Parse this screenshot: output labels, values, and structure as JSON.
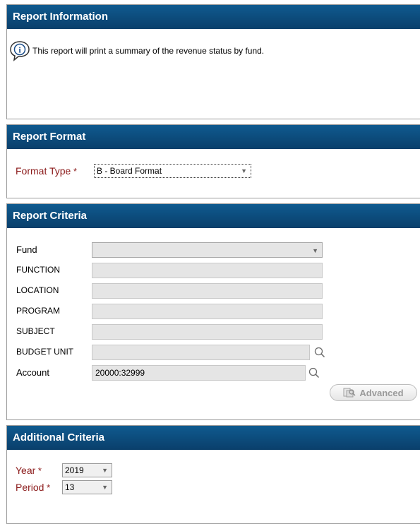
{
  "report_info": {
    "title": "Report Information",
    "message": "This report will print a summary of the revenue status by fund."
  },
  "report_format": {
    "title": "Report Format",
    "format_type_label": "Format Type",
    "required_mark": "*",
    "format_type_value": "B - Board Format"
  },
  "report_criteria": {
    "title": "Report Criteria",
    "fund_label": "Fund",
    "fund_value": "",
    "function_label": "FUNCTION",
    "location_label": "LOCATION",
    "program_label": "PROGRAM",
    "subject_label": "SUBJECT",
    "budget_unit_label": "BUDGET UNIT",
    "account_label": "Account",
    "account_value": "20000:32999",
    "advanced_label": "Advanced"
  },
  "additional_criteria": {
    "title": "Additional Criteria",
    "year_label": "Year",
    "year_value": "2019",
    "period_label": "Period",
    "period_value": "13",
    "required_mark": "*"
  },
  "colors": {
    "header_bg": "#0a4a7e",
    "required_label": "#8b1a1a"
  },
  "icons": [
    "info-icon",
    "magnifier-icon",
    "advanced-search-icon",
    "dropdown-arrow-icon"
  ]
}
